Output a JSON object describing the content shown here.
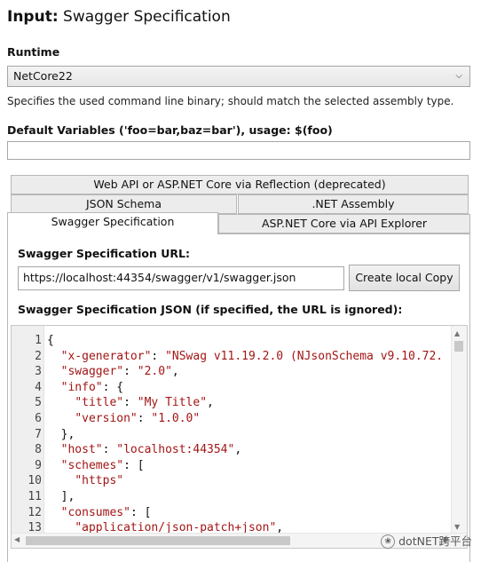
{
  "header": {
    "title_bold": "Input:",
    "title_rest": "Swagger Specification"
  },
  "runtime": {
    "label": "Runtime",
    "selected": "NetCore22",
    "description": "Specifies the used command line binary; should match the selected assembly type."
  },
  "default_variables": {
    "label": "Default Variables ('foo=bar,baz=bar'), usage: $(foo)",
    "value": ""
  },
  "tabs": [
    {
      "label": "Web API or ASP.NET Core via Reflection (deprecated)"
    },
    {
      "label": "JSON Schema"
    },
    {
      "label": ".NET Assembly"
    },
    {
      "label": "Swagger Specification",
      "active": true
    },
    {
      "label": "ASP.NET Core via API Explorer"
    }
  ],
  "swagger": {
    "url_label": "Swagger Specification URL:",
    "url_value": "https://localhost:44354/swagger/v1/swagger.json",
    "copy_button": "Create local Copy",
    "json_label": "Swagger Specification JSON (if specified, the URL is ignored):"
  },
  "editor": {
    "lines": [
      {
        "n": "1",
        "parts": [
          {
            "t": "{"
          }
        ]
      },
      {
        "n": "2",
        "parts": [
          {
            "t": "  "
          },
          {
            "t": "\"x-generator\"",
            "s": true
          },
          {
            "t": ": "
          },
          {
            "t": "\"NSwag v11.19.2.0 (NJsonSchema v9.10.72.",
            "s": true
          }
        ]
      },
      {
        "n": "3",
        "parts": [
          {
            "t": "  "
          },
          {
            "t": "\"swagger\"",
            "s": true
          },
          {
            "t": ": "
          },
          {
            "t": "\"2.0\"",
            "s": true
          },
          {
            "t": ","
          }
        ]
      },
      {
        "n": "4",
        "parts": [
          {
            "t": "  "
          },
          {
            "t": "\"info\"",
            "s": true
          },
          {
            "t": ": {"
          }
        ]
      },
      {
        "n": "5",
        "parts": [
          {
            "t": "    "
          },
          {
            "t": "\"title\"",
            "s": true
          },
          {
            "t": ": "
          },
          {
            "t": "\"My Title\"",
            "s": true
          },
          {
            "t": ","
          }
        ]
      },
      {
        "n": "6",
        "parts": [
          {
            "t": "    "
          },
          {
            "t": "\"version\"",
            "s": true
          },
          {
            "t": ": "
          },
          {
            "t": "\"1.0.0\"",
            "s": true
          }
        ]
      },
      {
        "n": "7",
        "parts": [
          {
            "t": "  },"
          }
        ]
      },
      {
        "n": "8",
        "parts": [
          {
            "t": "  "
          },
          {
            "t": "\"host\"",
            "s": true
          },
          {
            "t": ": "
          },
          {
            "t": "\"localhost:44354\"",
            "s": true
          },
          {
            "t": ","
          }
        ]
      },
      {
        "n": "9",
        "parts": [
          {
            "t": "  "
          },
          {
            "t": "\"schemes\"",
            "s": true
          },
          {
            "t": ": ["
          }
        ]
      },
      {
        "n": "10",
        "parts": [
          {
            "t": "    "
          },
          {
            "t": "\"https\"",
            "s": true
          }
        ]
      },
      {
        "n": "11",
        "parts": [
          {
            "t": "  ],"
          }
        ]
      },
      {
        "n": "12",
        "parts": [
          {
            "t": "  "
          },
          {
            "t": "\"consumes\"",
            "s": true
          },
          {
            "t": ": ["
          }
        ]
      },
      {
        "n": "13",
        "parts": [
          {
            "t": "    "
          },
          {
            "t": "\"application/json-patch+json\"",
            "s": true
          },
          {
            "t": ","
          }
        ]
      }
    ]
  },
  "watermark": {
    "text": "dotNET跨平台"
  },
  "colors": {
    "string": "#a31515",
    "border": "#b8b8b8",
    "tab_bg": "#ececec"
  }
}
